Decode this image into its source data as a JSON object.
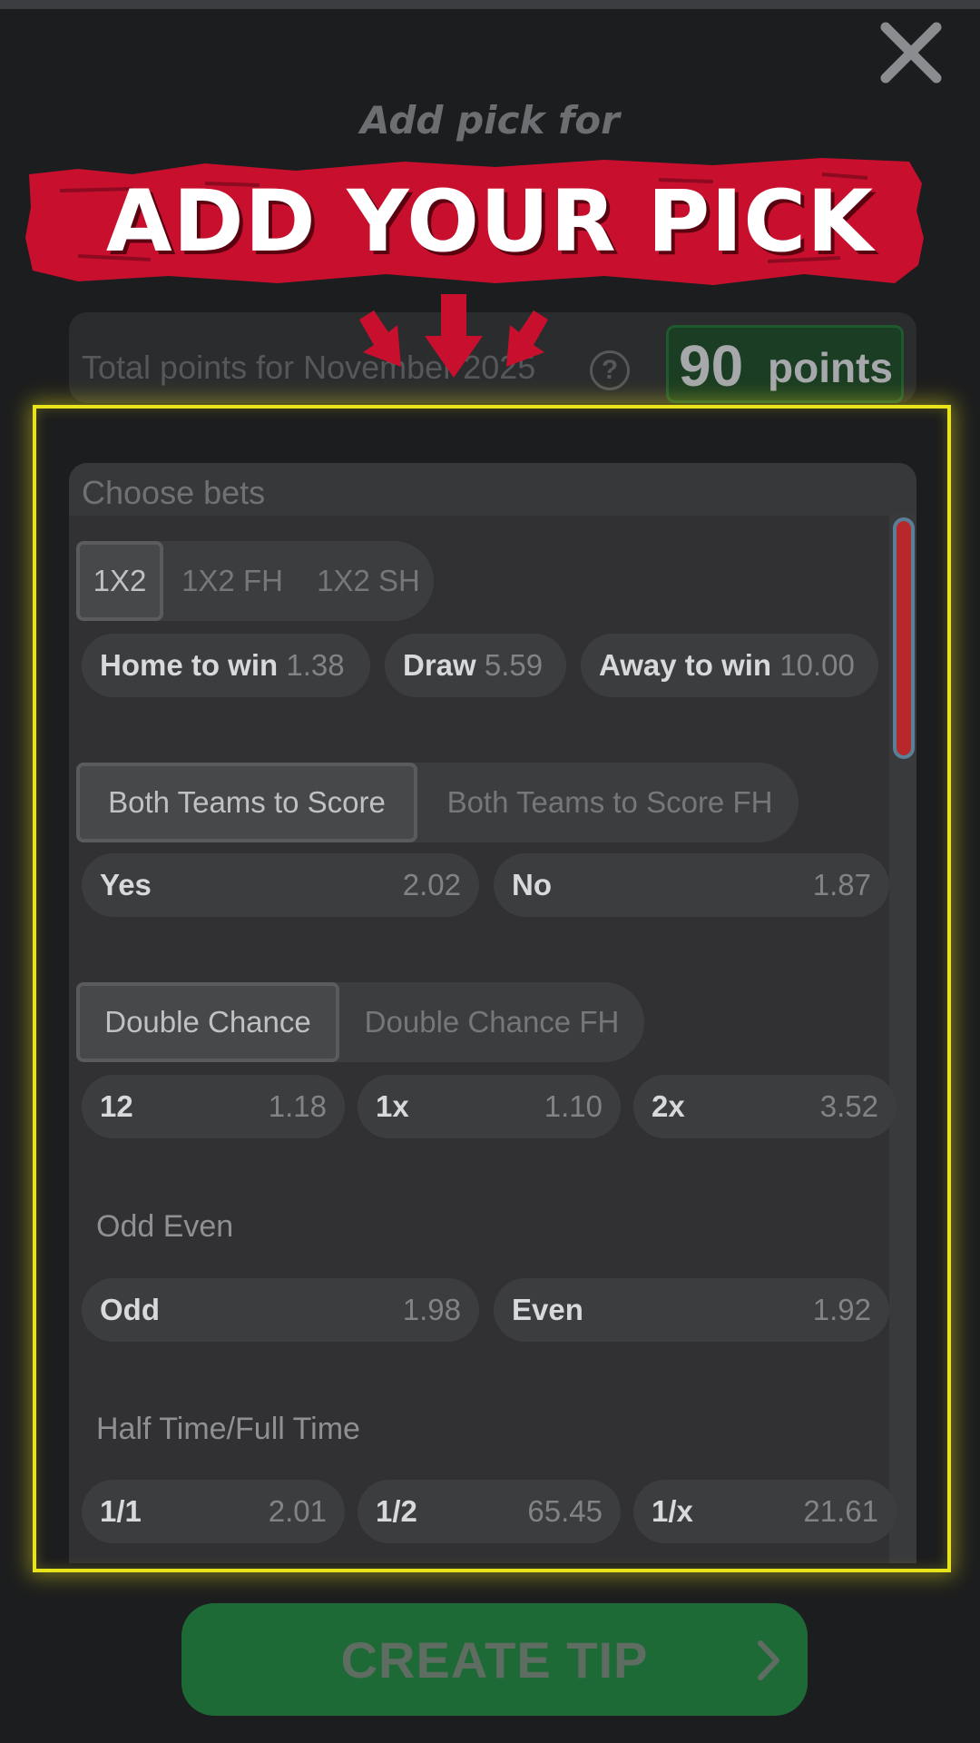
{
  "header": {
    "close_icon": "close-icon",
    "add_pick_for": "Add pick for",
    "banner_text": "ADD YOUR PICK",
    "banner_color": "#c8102e"
  },
  "points": {
    "label": "Total points for November 2025",
    "help_icon": "question-circle-icon",
    "value": "90",
    "unit": "points"
  },
  "bets_panel": {
    "header": "Choose bets",
    "groups": {
      "result": {
        "tabs": [
          "1X2",
          "1X2 FH",
          "1X2 SH"
        ],
        "active_tab": "1X2",
        "options": [
          {
            "label": "Home to win",
            "odd": "1.38"
          },
          {
            "label": "Draw",
            "odd": "5.59"
          },
          {
            "label": "Away to win",
            "odd": "10.00"
          }
        ]
      },
      "btts": {
        "tabs": [
          "Both Teams to Score",
          "Both Teams to Score FH"
        ],
        "active_tab": "Both Teams to Score",
        "options": [
          {
            "label": "Yes",
            "odd": "2.02"
          },
          {
            "label": "No",
            "odd": "1.87"
          }
        ]
      },
      "double_chance": {
        "tabs": [
          "Double Chance",
          "Double Chance FH"
        ],
        "active_tab": "Double Chance",
        "options": [
          {
            "label": "12",
            "odd": "1.18"
          },
          {
            "label": "1x",
            "odd": "1.10"
          },
          {
            "label": "2x",
            "odd": "3.52"
          }
        ]
      },
      "odd_even": {
        "title": "Odd Even",
        "options": [
          {
            "label": "Odd",
            "odd": "1.98"
          },
          {
            "label": "Even",
            "odd": "1.92"
          }
        ]
      },
      "htft": {
        "title": "Half Time/Full Time",
        "options": [
          {
            "label": "1/1",
            "odd": "2.01"
          },
          {
            "label": "1/2",
            "odd": "65.45"
          },
          {
            "label": "1/x",
            "odd": "21.61"
          }
        ]
      }
    }
  },
  "cta": {
    "label": "CREATE TIP",
    "icon": "chevron-right-icon",
    "color": "#1e6a36"
  },
  "highlight_color": "#e8e31a"
}
